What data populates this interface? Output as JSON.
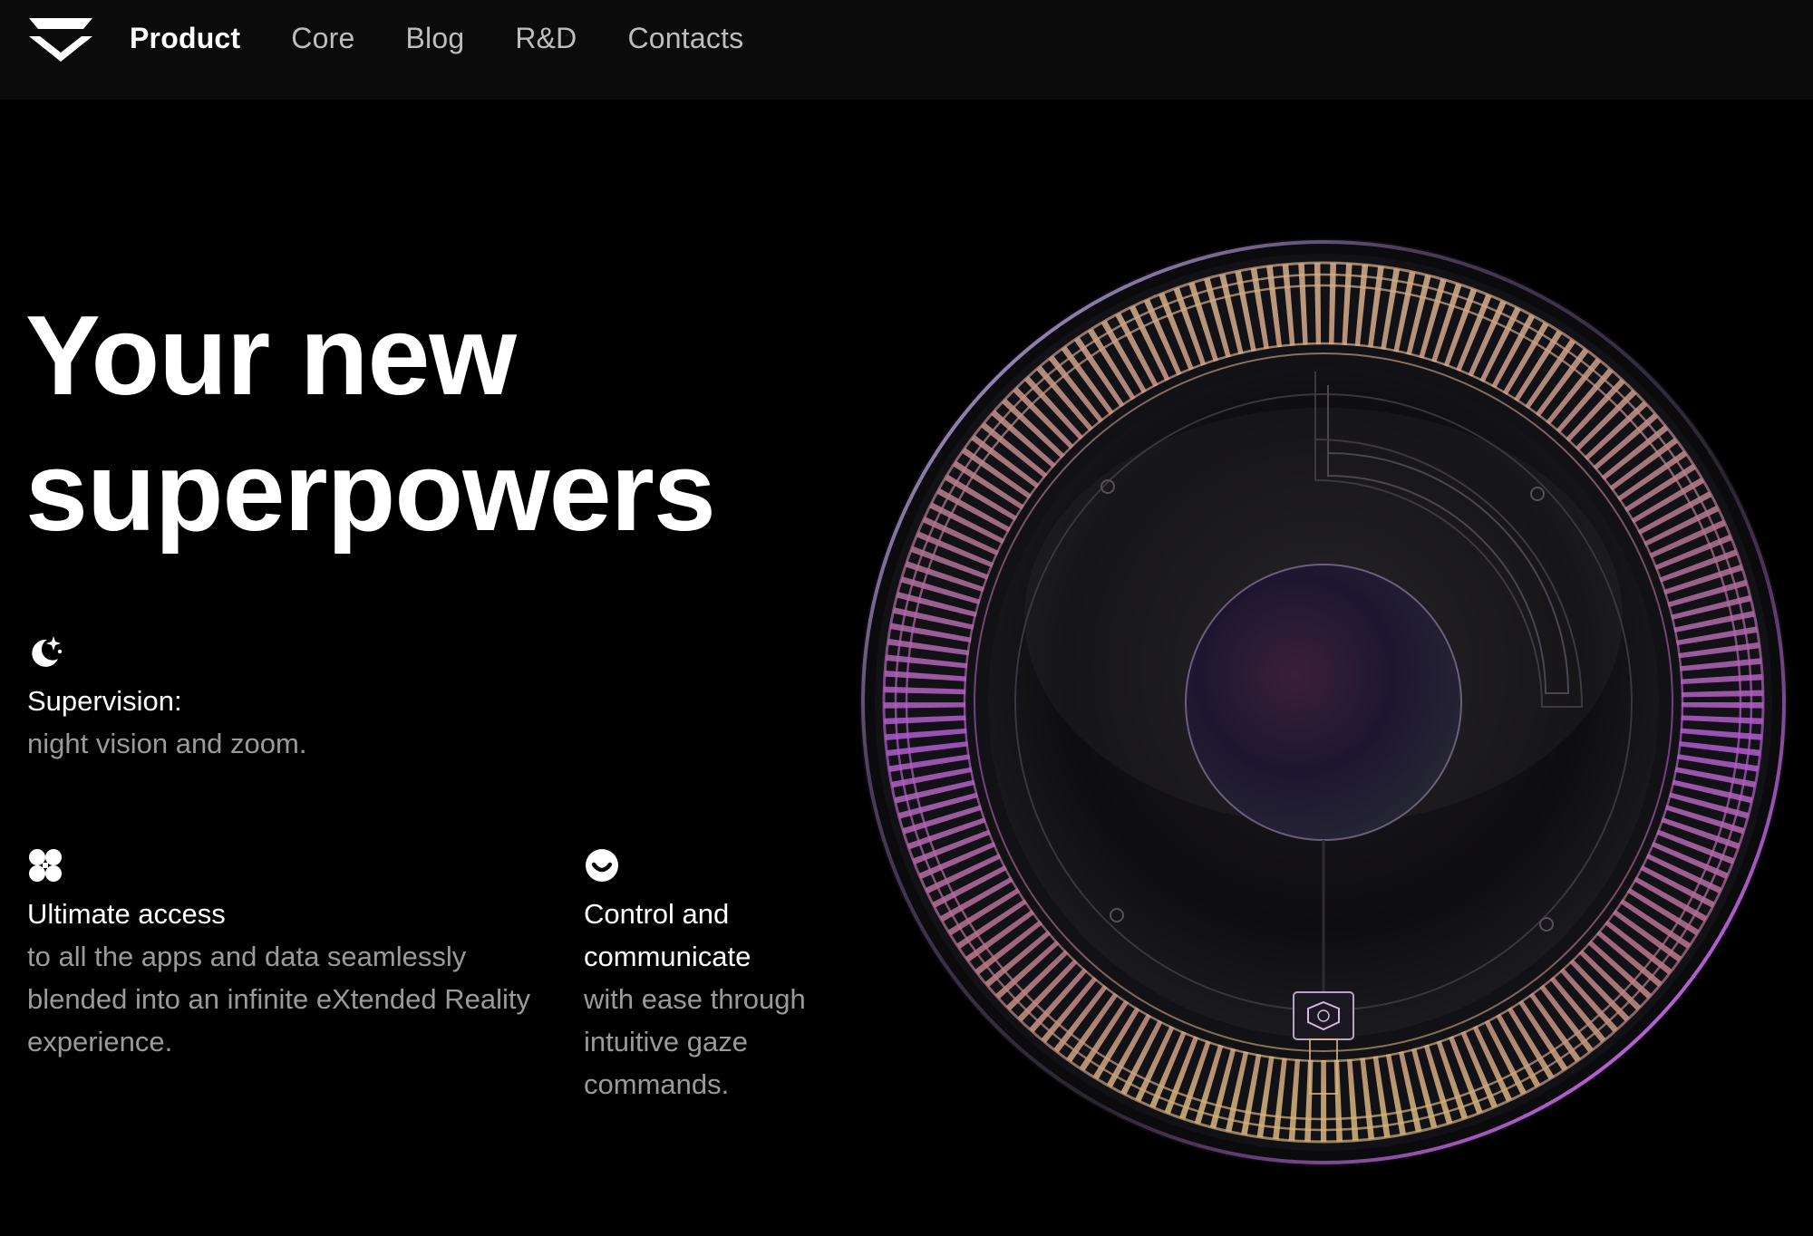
{
  "nav": {
    "items": [
      {
        "label": "Product",
        "active": true
      },
      {
        "label": "Core",
        "active": false
      },
      {
        "label": "Blog",
        "active": false
      },
      {
        "label": "R&D",
        "active": false
      },
      {
        "label": "Contacts",
        "active": false
      }
    ]
  },
  "hero": {
    "title_line1": "Your new",
    "title_line2": "superpowers"
  },
  "features": [
    {
      "icon": "moon-stars-icon",
      "title": "Supervision:",
      "desc": "night vision and zoom."
    },
    {
      "icon": "four-petals-icon",
      "title": "Ultimate access",
      "desc": "to all the apps and data seamlessly blended into an infinite eXtended Reality experience."
    },
    {
      "icon": "smile-icon",
      "title": "Control and communicate",
      "desc": "with ease through intuitive gaze commands."
    }
  ],
  "colors": {
    "background": "#000000",
    "nav_background": "#0b0b0b",
    "text_primary": "#ffffff",
    "text_secondary": "#9a9a9a",
    "nav_inactive": "#bdbdbd",
    "accent_purple": "#b85ad8",
    "accent_gold": "#c9a97a"
  }
}
